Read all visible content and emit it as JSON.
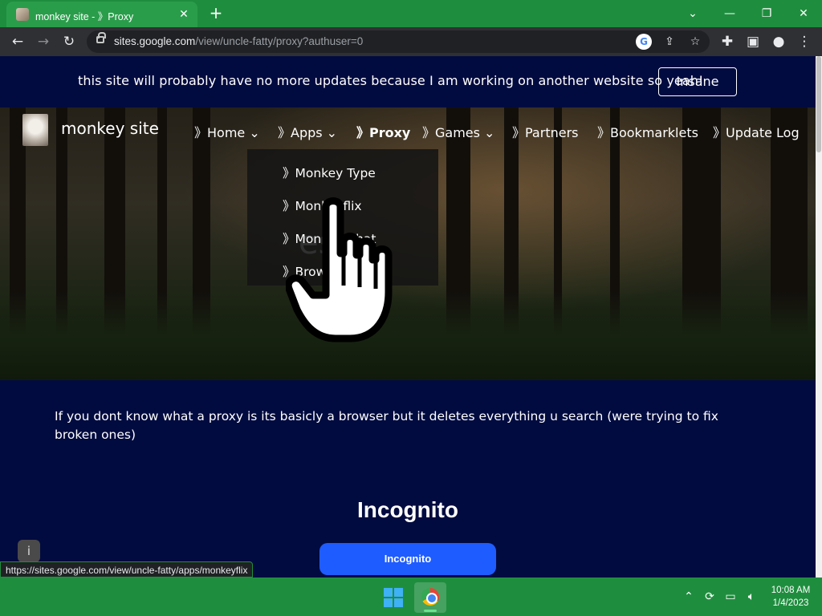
{
  "browser": {
    "tab": {
      "title": "monkey site - 》Proxy",
      "close": "✕"
    },
    "new_tab": "+",
    "window_controls": {
      "dropdown": "⌄",
      "minimize": "—",
      "restore": "❐",
      "close": "✕"
    },
    "url_host": "sites.google.com",
    "url_path": "/view/uncle-fatty/proxy?authuser=0",
    "status_url": "https://sites.google.com/view/uncle-fatty/apps/monkeyflix"
  },
  "announcement": {
    "text": "this site will probably have no more updates because I am working on another website so yeah!",
    "button": "Insane"
  },
  "site": {
    "name": "monkey site",
    "nav": [
      "》Home ⌄",
      "》Apps ⌄",
      "》Proxy",
      "》Games ⌄",
      "》Partners",
      "》Bookmarklets",
      "》Update Log"
    ],
    "apps_menu": [
      "》Monkey Type",
      "》Monkeyflix",
      "》Monkey Chat",
      "》Browser"
    ],
    "hero_title_partial": "es"
  },
  "content": {
    "description": "If you dont know what a proxy is its basicly a browser but it deletes everything u search (were trying to fix broken ones)",
    "incognito_heading": "Incognito",
    "incognito_button": "Incognito",
    "info_icon": "i"
  },
  "taskbar": {
    "time": "10:08 AM",
    "date": "1/4/2023"
  },
  "colors": {
    "tab_strip": "#1e8e3e",
    "page_bg": "#020b3f",
    "primary_button": "#1f5cff"
  }
}
